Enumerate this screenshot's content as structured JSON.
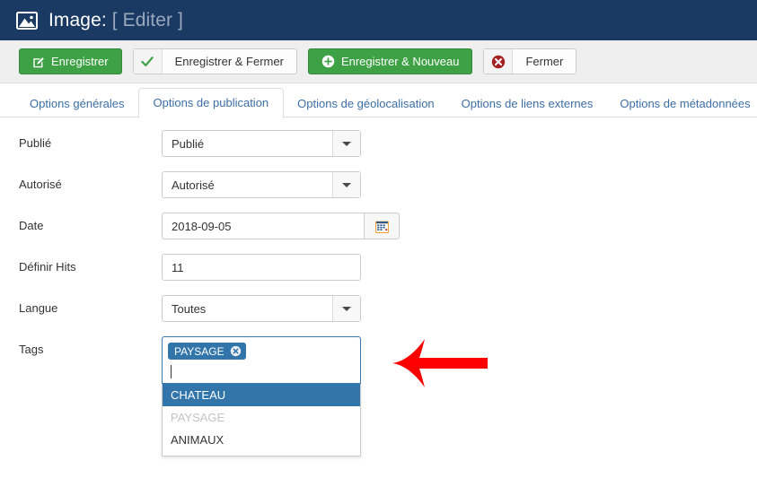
{
  "header": {
    "icon": "image-icon",
    "title_prefix": "Image:",
    "title_suffix": "[ Editer ]",
    "background_color": "#1b3a63"
  },
  "toolbar": {
    "buttons": [
      {
        "label": "Enregistrer",
        "icon": "pencil-square-icon",
        "style": "green"
      },
      {
        "label": "Enregistrer & Fermer",
        "icon": "check-icon",
        "style": "split"
      },
      {
        "label": "Enregistrer & Nouveau",
        "icon": "plus-circle-icon",
        "style": "green"
      },
      {
        "label": "Fermer",
        "icon": "close-circle-icon",
        "style": "split"
      }
    ],
    "green_color": "#3fa145",
    "close_icon_color": "#a52121"
  },
  "tabs": [
    {
      "label": "Options générales",
      "active": false
    },
    {
      "label": "Options de publication",
      "active": true
    },
    {
      "label": "Options de géolocalisation",
      "active": false
    },
    {
      "label": "Options de liens externes",
      "active": false
    },
    {
      "label": "Options de métadonnées",
      "active": false
    }
  ],
  "form": {
    "published": {
      "label": "Publié",
      "value": "Publié"
    },
    "authorized": {
      "label": "Autorisé",
      "value": "Autorisé"
    },
    "date": {
      "label": "Date",
      "value": "2018-09-05",
      "button_icon": "calendar-icon"
    },
    "hits": {
      "label": "Définir Hits",
      "value": "11"
    },
    "language": {
      "label": "Langue",
      "value": "Toutes"
    },
    "tags": {
      "label": "Tags",
      "selected": [
        {
          "label": "PAYSAGE",
          "remove_icon": "remove-circle-icon"
        }
      ],
      "input_value": "",
      "dropdown": [
        {
          "label": "CHATEAU",
          "state": "highlighted"
        },
        {
          "label": "PAYSAGE",
          "state": "disabled"
        },
        {
          "label": "ANIMAUX",
          "state": "normal"
        }
      ],
      "chip_color": "#3275ab",
      "focus_border_color": "#3c7ab5"
    }
  },
  "annotation": {
    "arrow": "left-pointing-arrow",
    "color": "#fc0000"
  }
}
